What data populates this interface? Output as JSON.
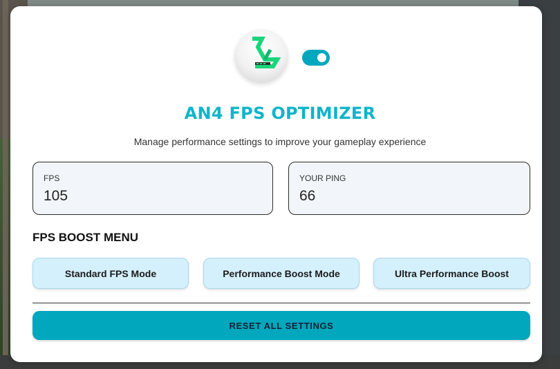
{
  "app": {
    "title": "AN4 FPS OPTIMIZER",
    "subtitle": "Manage performance settings to improve your gameplay experience",
    "logo_icon": "an4-logo-icon",
    "accent_color": "#00a7bd",
    "title_color": "#0fb5c9"
  },
  "toggle": {
    "state": "on"
  },
  "stats": {
    "fps": {
      "label": "FPS",
      "value": "105"
    },
    "ping": {
      "label": "YOUR PING",
      "value": "66"
    }
  },
  "boost_menu": {
    "title": "FPS BOOST MENU",
    "modes": [
      {
        "label": "Standard FPS Mode"
      },
      {
        "label": "Performance Boost Mode"
      },
      {
        "label": "Ultra Performance Boost"
      }
    ]
  },
  "reset": {
    "label": "RESET ALL SETTINGS"
  }
}
